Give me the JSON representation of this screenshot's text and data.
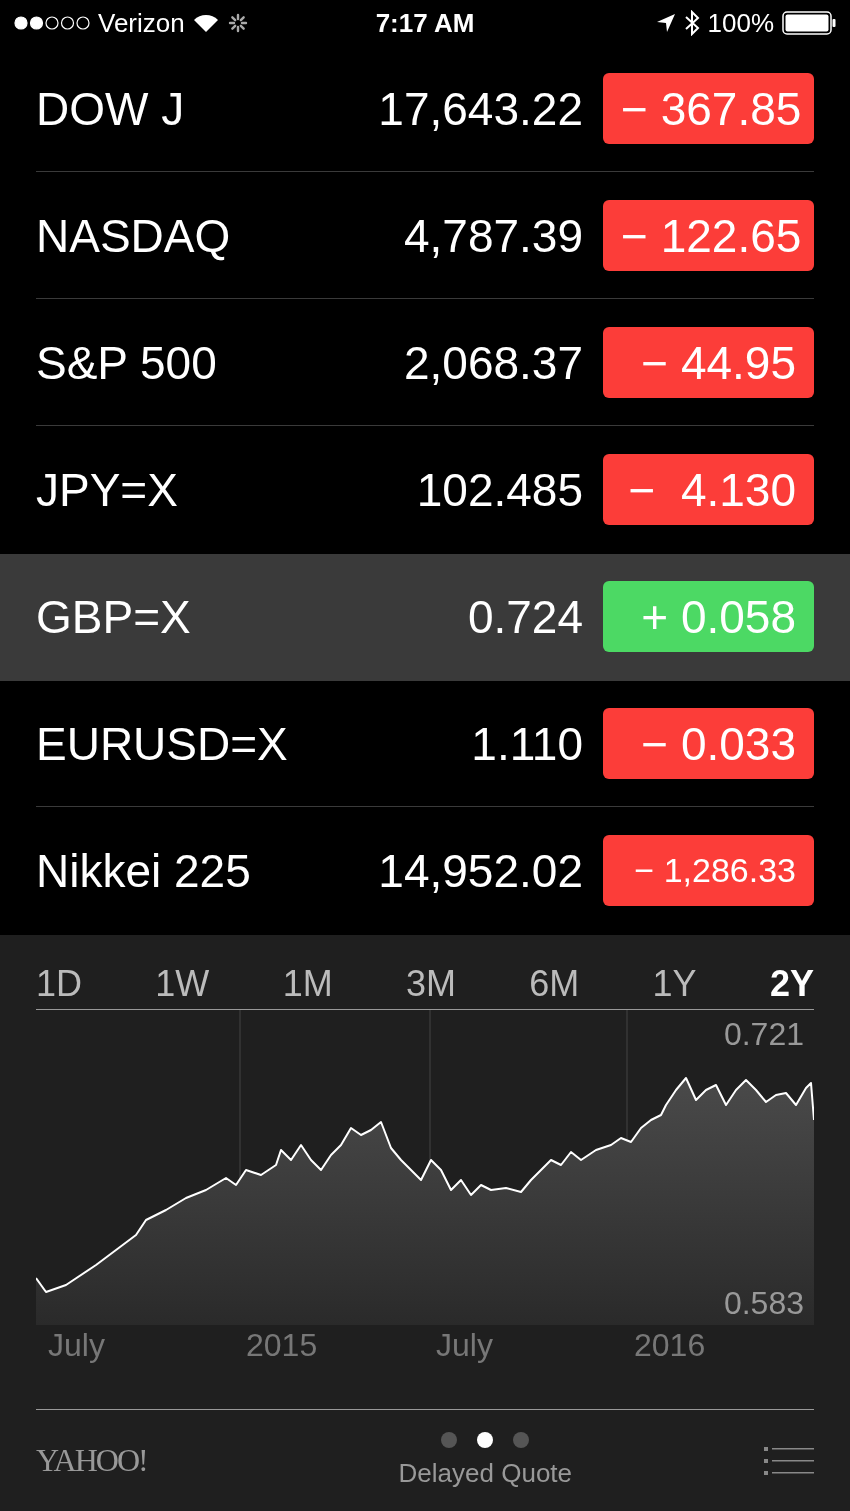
{
  "status_bar": {
    "carrier": "Verizon",
    "time": "7:17 AM",
    "battery": "100%"
  },
  "quotes": [
    {
      "symbol": "DOW J",
      "price": "17,643.22",
      "change": "− 367.85",
      "color": "#fc3d39",
      "selected": false
    },
    {
      "symbol": "NASDAQ",
      "price": "4,787.39",
      "change": "− 122.65",
      "color": "#fc3d39",
      "selected": false
    },
    {
      "symbol": "S&P 500",
      "price": "2,068.37",
      "change": "− 44.95",
      "color": "#fc3d39",
      "selected": false
    },
    {
      "symbol": "JPY=X",
      "price": "102.485",
      "change": "−  4.130",
      "color": "#fc3d39",
      "selected": false
    },
    {
      "symbol": "GBP=X",
      "price": "0.724",
      "change": "+ 0.058",
      "color": "#4cd964",
      "selected": true
    },
    {
      "symbol": "EURUSD=X",
      "price": "1.110",
      "change": "− 0.033",
      "color": "#fc3d39",
      "selected": false
    },
    {
      "symbol": "Nikkei 225",
      "price": "14,952.02",
      "change": "− 1,286.33",
      "color": "#fc3d39",
      "selected": false
    }
  ],
  "ranges": [
    {
      "label": "1D",
      "selected": false
    },
    {
      "label": "1W",
      "selected": false
    },
    {
      "label": "1M",
      "selected": false
    },
    {
      "label": "3M",
      "selected": false
    },
    {
      "label": "6M",
      "selected": false
    },
    {
      "label": "1Y",
      "selected": false
    },
    {
      "label": "2Y",
      "selected": true
    }
  ],
  "chart": {
    "max_label": "0.721",
    "min_label": "0.583",
    "x_labels": [
      "July",
      "2015",
      "July",
      "2016"
    ]
  },
  "footer": {
    "logo": "YAHOO!",
    "pages": [
      {
        "selected": false
      },
      {
        "selected": true
      },
      {
        "selected": false
      }
    ],
    "caption": "Delayed Quote"
  }
}
